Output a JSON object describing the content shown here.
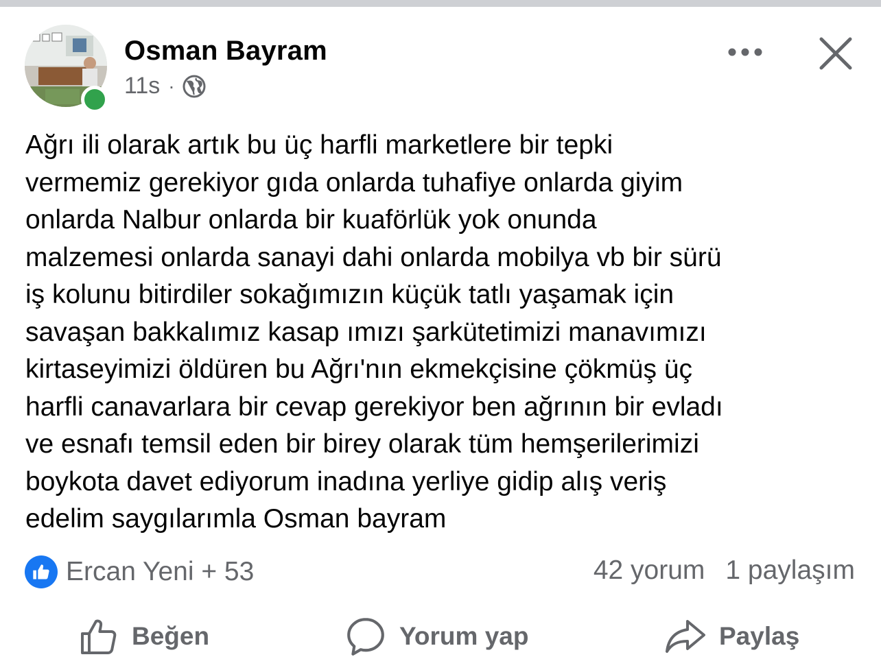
{
  "post": {
    "author": "Osman Bayram",
    "time": "11s",
    "separator": "·",
    "audience_icon": "globe-icon",
    "online": true,
    "text": "Ağrı ili olarak artık  bu üç harfli marketlere bir tepki\nvermemiz gerekiyor gıda onlarda tuhafiye onlarda giyim\nonlarda Nalbur onlarda bir kuaförlük yok onunda\nmalzemesi onlarda sanayi dahi onlarda mobilya vb bir sürü\niş kolunu bitirdiler sokağımızın küçük tatlı yaşamak için\nsavaşan bakkalımız kasap ımızı şarkütetimizi manavımızı\nkirtaseyimizi öldüren bu Ağrı'nın ekmekçisine çökmüş üç\nharfli  canavarlara bir cevap gerekiyor ben ağrının bir evladı\nve esnafı temsil eden bir birey olarak tüm hemşerilerimizi\nboykota davet ediyorum inadına yerliye gidip alış veriş\nedelim saygılarımla Osman bayram"
  },
  "reactions": {
    "summary": "Ercan Yeni + 53",
    "icon": "like-icon",
    "color": "#1877f2"
  },
  "stats": {
    "comments": "42 yorum",
    "shares": "1 paylaşım"
  },
  "actions": {
    "like": "Beğen",
    "comment": "Yorum yap",
    "share": "Paylaş"
  },
  "colors": {
    "text": "#050505",
    "secondary": "#65676b",
    "online": "#31a24c",
    "brand": "#1877f2"
  }
}
